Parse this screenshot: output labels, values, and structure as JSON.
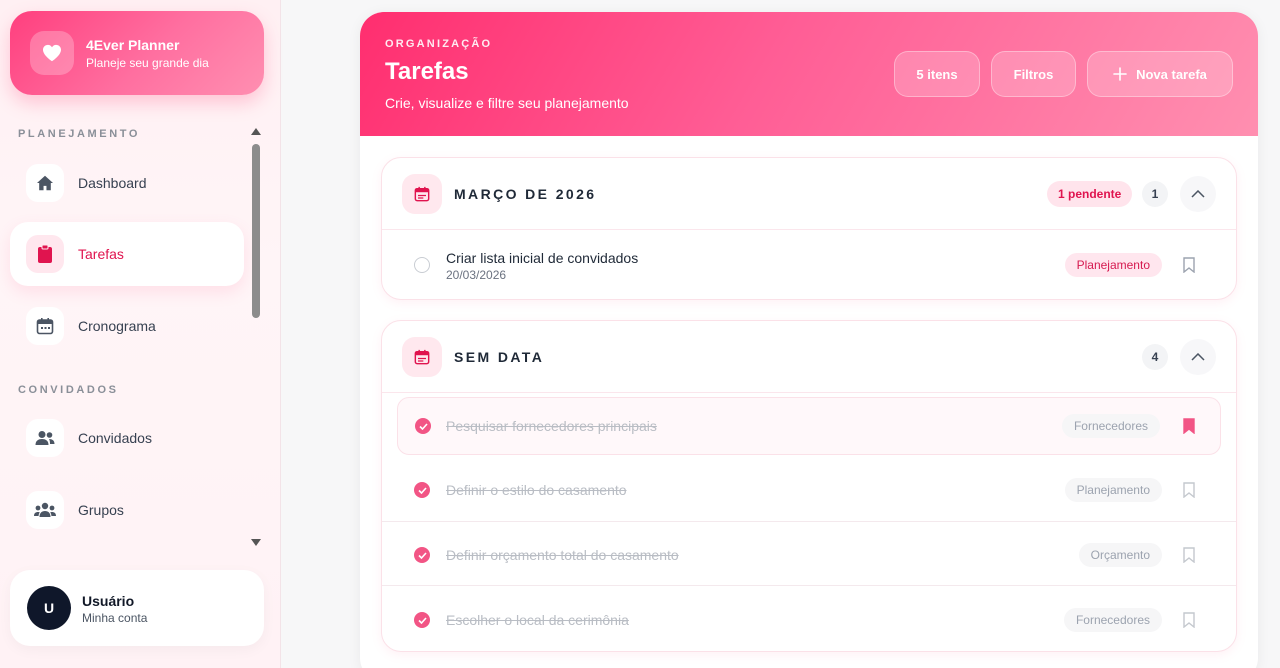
{
  "brand": {
    "title": "4Ever Planner",
    "subtitle": "Planeje seu grande dia"
  },
  "sidebar": {
    "sections": [
      {
        "label": "PLANEJAMENTO"
      },
      {
        "label": "CONVIDADOS"
      }
    ],
    "items": [
      {
        "label": "Dashboard",
        "icon": "home-icon"
      },
      {
        "label": "Tarefas",
        "icon": "clipboard-icon",
        "active": true
      },
      {
        "label": "Cronograma",
        "icon": "calendar-icon"
      },
      {
        "label": "Convidados",
        "icon": "users-icon"
      },
      {
        "label": "Grupos",
        "icon": "group-icon"
      }
    ]
  },
  "user": {
    "initial": "U",
    "name": "Usuário",
    "subtitle": "Minha conta"
  },
  "header": {
    "eyebrow": "ORGANIZAÇÃO",
    "title": "Tarefas",
    "subtitle": "Crie, visualize e filtre seu planejamento",
    "items_button": "5 itens",
    "filters_button": "Filtros",
    "new_task_button": "Nova tarefa"
  },
  "groups": [
    {
      "title": "MARÇO DE 2026",
      "pending": "1 pendente",
      "count": "1",
      "tasks": [
        {
          "title": "Criar lista inicial de convidados",
          "date": "20/03/2026",
          "tag": "Planejamento",
          "done": false
        }
      ]
    },
    {
      "title": "SEM DATA",
      "count": "4",
      "tasks": [
        {
          "title": "Pesquisar fornecedores principais",
          "tag": "Fornecedores",
          "done": true,
          "bookmarked": true
        },
        {
          "title": "Definir o estilo do casamento",
          "tag": "Planejamento",
          "done": true
        },
        {
          "title": "Definir orçamento total do casamento",
          "tag": "Orçamento",
          "done": true
        },
        {
          "title": "Escolher o local da cerimônia",
          "tag": "Fornecedores",
          "done": true
        }
      ]
    }
  ],
  "colors": {
    "accent": "#ff3f7e",
    "accent_dark": "#e0144f",
    "check": "#f25585"
  }
}
